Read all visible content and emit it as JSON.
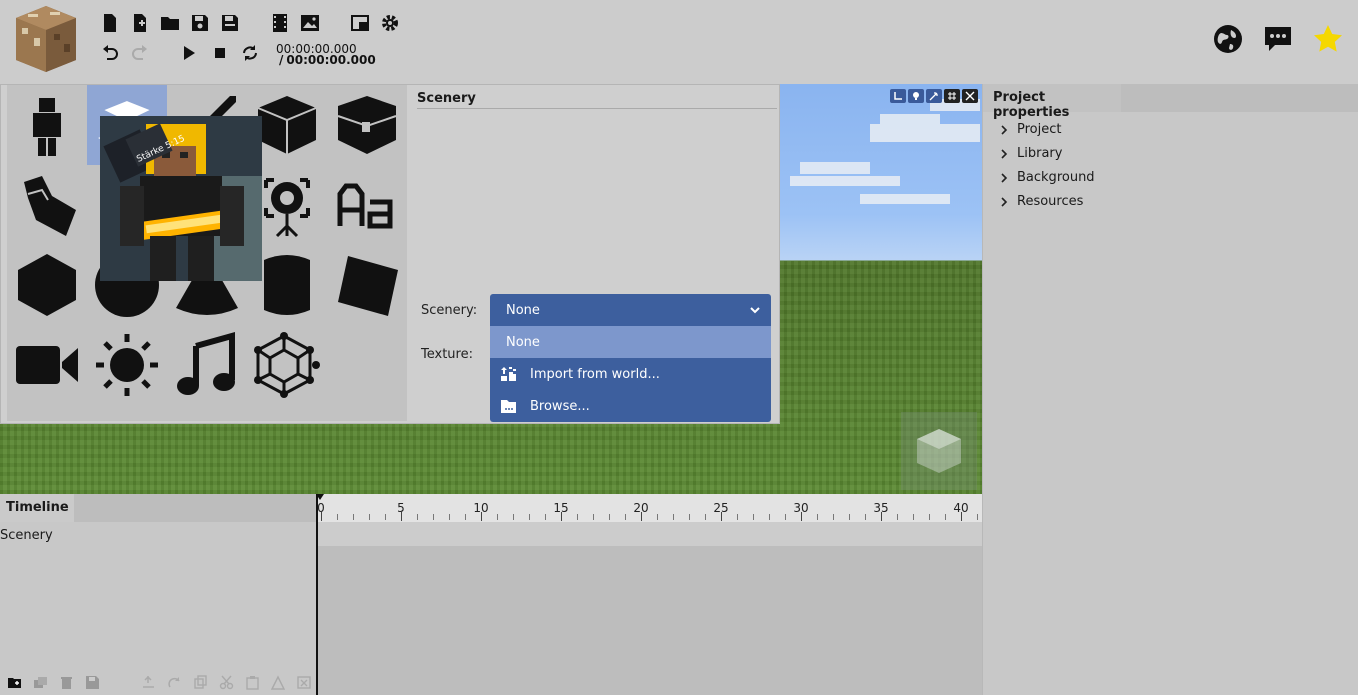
{
  "toolbar": {
    "time_current": "00:00:00.000",
    "time_total_prefix": "/",
    "time_total": "00:00:00.000"
  },
  "add_panel": {
    "section_title": "Scenery",
    "scenery_label": "Scenery:",
    "texture_label": "Texture:",
    "preview_text": "Stärke 5:15",
    "selected_scenery": "None",
    "options": [
      {
        "label": "None",
        "icon": "none"
      },
      {
        "label": "Import from world...",
        "icon": "import-world-icon"
      },
      {
        "label": "Browse...",
        "icon": "folder-icon"
      }
    ]
  },
  "right_panel": {
    "tab": "Project properties",
    "items": [
      "Project",
      "Library",
      "Background",
      "Resources"
    ]
  },
  "timeline": {
    "tab": "Timeline",
    "row": "Scenery",
    "ticks": [
      {
        "label": "0"
      },
      {
        "label": "5"
      },
      {
        "label": "10"
      },
      {
        "label": "15"
      },
      {
        "label": "20"
      },
      {
        "label": "25"
      },
      {
        "label": "30"
      },
      {
        "label": "35"
      },
      {
        "label": "40"
      }
    ]
  },
  "colors": {
    "accent": "#3d5f9e",
    "selected_option": "#7d97cc",
    "active_cell": "#8fa6d4",
    "star": "#f5d800"
  }
}
